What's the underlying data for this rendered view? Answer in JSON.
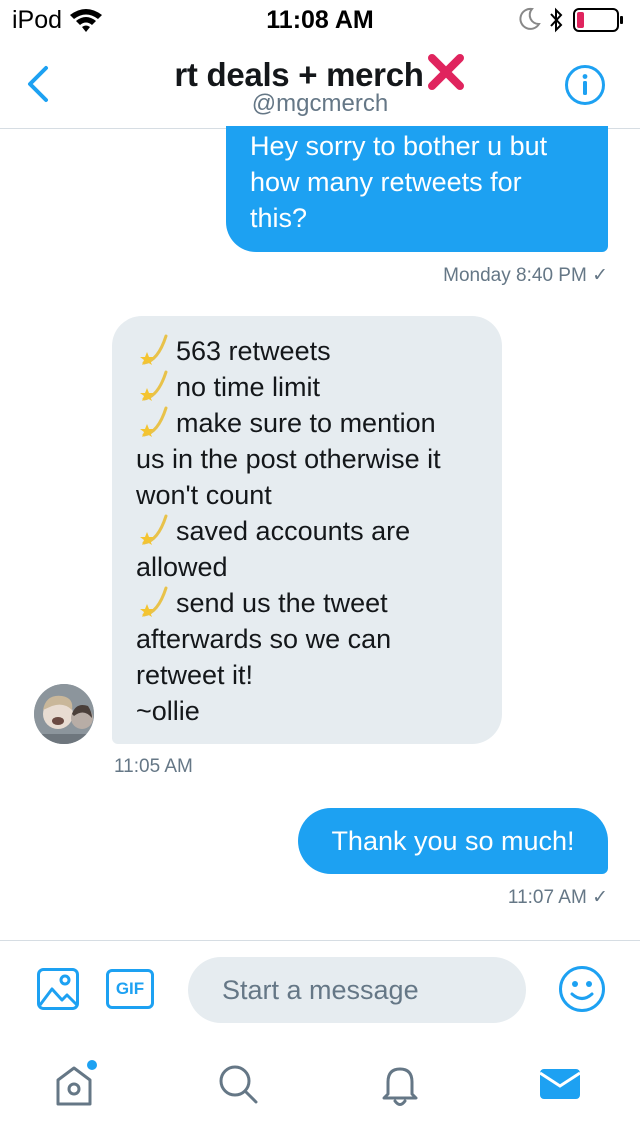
{
  "status_bar": {
    "carrier": "iPod",
    "time": "11:08 AM"
  },
  "header": {
    "title": "rt deals + merch",
    "title_icon": "red-x-emoji",
    "handle": "@mgcmerch"
  },
  "messages": [
    {
      "direction": "outgoing",
      "lines": [
        "Hey sorry to bother u but",
        "how many retweets for",
        "this?"
      ],
      "meta": "Monday 8:40 PM ✓"
    },
    {
      "direction": "incoming",
      "lines": [
        {
          "emoji": "dizzy",
          "text": "563 retweets"
        },
        {
          "emoji": "dizzy",
          "text": "no time limit"
        },
        {
          "emoji": "dizzy",
          "text": "make sure to mention"
        },
        {
          "text": "us in the post otherwise it"
        },
        {
          "text": "won't count"
        },
        {
          "emoji": "dizzy",
          "text": "saved accounts are"
        },
        {
          "text": "allowed"
        },
        {
          "emoji": "dizzy",
          "text": "send us the tweet"
        },
        {
          "text": "afterwards so we can"
        },
        {
          "text": "retweet it!"
        },
        {
          "text": "~ollie"
        }
      ],
      "meta": "11:05 AM"
    },
    {
      "direction": "outgoing",
      "text": "Thank you so much!",
      "meta": "11:07 AM ✓"
    }
  ],
  "composer": {
    "placeholder": "Start a message",
    "gif_label": "GIF"
  },
  "tabs": [
    "home",
    "search",
    "notifications",
    "messages"
  ],
  "colors": {
    "accent": "#1da1f2",
    "bubble_in": "#e6ecf0",
    "muted": "#657786",
    "battery_low": "#e0245e",
    "x_mark": "#e0245e"
  }
}
